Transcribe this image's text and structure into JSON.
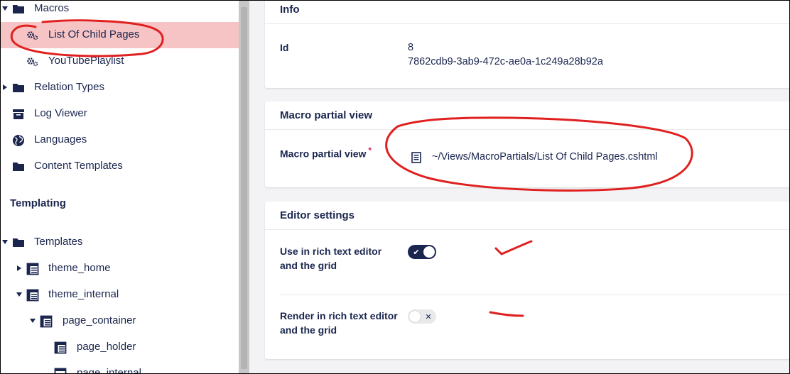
{
  "sidebar": {
    "items": [
      {
        "label": "Macros"
      },
      {
        "label": "List Of Child Pages"
      },
      {
        "label": "YouTubePlaylist"
      },
      {
        "label": "Relation Types"
      },
      {
        "label": "Log Viewer"
      },
      {
        "label": "Languages"
      },
      {
        "label": "Content Templates"
      }
    ],
    "templating_title": "Templating",
    "templates": [
      {
        "label": "Templates"
      },
      {
        "label": "theme_home"
      },
      {
        "label": "theme_internal"
      },
      {
        "label": "page_container"
      },
      {
        "label": "page_holder"
      },
      {
        "label": "page_internal"
      }
    ]
  },
  "info": {
    "title": "Info",
    "id_label": "Id",
    "id_value": "8",
    "guid": "7862cdb9-3ab9-472c-ae0a-1c249a28b92a"
  },
  "macro_partial": {
    "title": "Macro partial view",
    "label": "Macro partial view",
    "required_mark": "*",
    "path": "~/Views/MacroPartials/List Of Child Pages.cshtml"
  },
  "editor_settings": {
    "title": "Editor settings",
    "use_rte_label_line1": "Use in rich text editor",
    "use_rte_label_line2": "and the grid",
    "use_rte_on": true,
    "render_rte_label_line1": "Render in rich text editor",
    "render_rte_label_line2": "and the grid",
    "render_rte_on": false
  },
  "colors": {
    "primary": "#1b264f",
    "selected": "#f6c4c4",
    "annotation": "#e02020",
    "required": "#d42054"
  }
}
